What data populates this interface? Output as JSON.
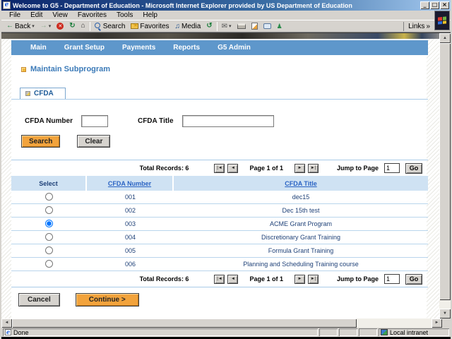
{
  "colors": {
    "titlebar_blue": "#0A246A",
    "nav_blue": "#5E97CB",
    "accent_orange": "#F2A33C",
    "link_blue": "#2B64C4",
    "table_header_bg": "#CFE2F3",
    "row_text_navy": "#1F4178"
  },
  "window": {
    "title": "Welcome to G5 - Department of Education - Microsoft Internet Explorer provided by US Department of Education",
    "titlebar_buttons": {
      "minimize": "_",
      "restore": "□",
      "close": "×"
    },
    "menu_items": [
      "File",
      "Edit",
      "View",
      "Favorites",
      "Tools",
      "Help"
    ],
    "toolbar": {
      "back_label": "Back",
      "search_label": "Search",
      "favorites_label": "Favorites",
      "media_label": "Media"
    },
    "links_label": "Links",
    "links_chevron": "»",
    "status": {
      "done": "Done",
      "zone": "Local intranet"
    }
  },
  "navbar": {
    "items": [
      "Main",
      "Grant Setup",
      "Payments",
      "Reports",
      "G5 Admin"
    ]
  },
  "page": {
    "heading": "Maintain Subprogram",
    "tab_label": "CFDA"
  },
  "search_form": {
    "cfda_number_label": "CFDA Number",
    "cfda_number_value": "",
    "cfda_title_label": "CFDA Title",
    "cfda_title_value": "",
    "search_label": "Search",
    "clear_label": "Clear"
  },
  "pagination": {
    "total_label": "Total Records: 6",
    "page_label": "Page 1 of 1",
    "jump_label": "Jump to Page",
    "jump_value": "1",
    "go_label": "Go",
    "first_icon": "|◄",
    "prev_icon": "◄",
    "next_icon": "►",
    "last_icon": "►|"
  },
  "table": {
    "headers": [
      "Select",
      "CFDA Number",
      "CFDA Title"
    ],
    "rows": [
      {
        "number": "001",
        "title": "dec15"
      },
      {
        "number": "002",
        "title": "Dec 15th test"
      },
      {
        "number": "003",
        "title": "ACME Grant Program",
        "checked": "checked"
      },
      {
        "number": "004",
        "title": "Discretionary Grant Training"
      },
      {
        "number": "005",
        "title": "Formula Grant Training"
      },
      {
        "number": "006",
        "title": "Planning and Scheduling Training course"
      }
    ]
  },
  "actions": {
    "cancel_label": "Cancel",
    "continue_label": "Continue >"
  }
}
